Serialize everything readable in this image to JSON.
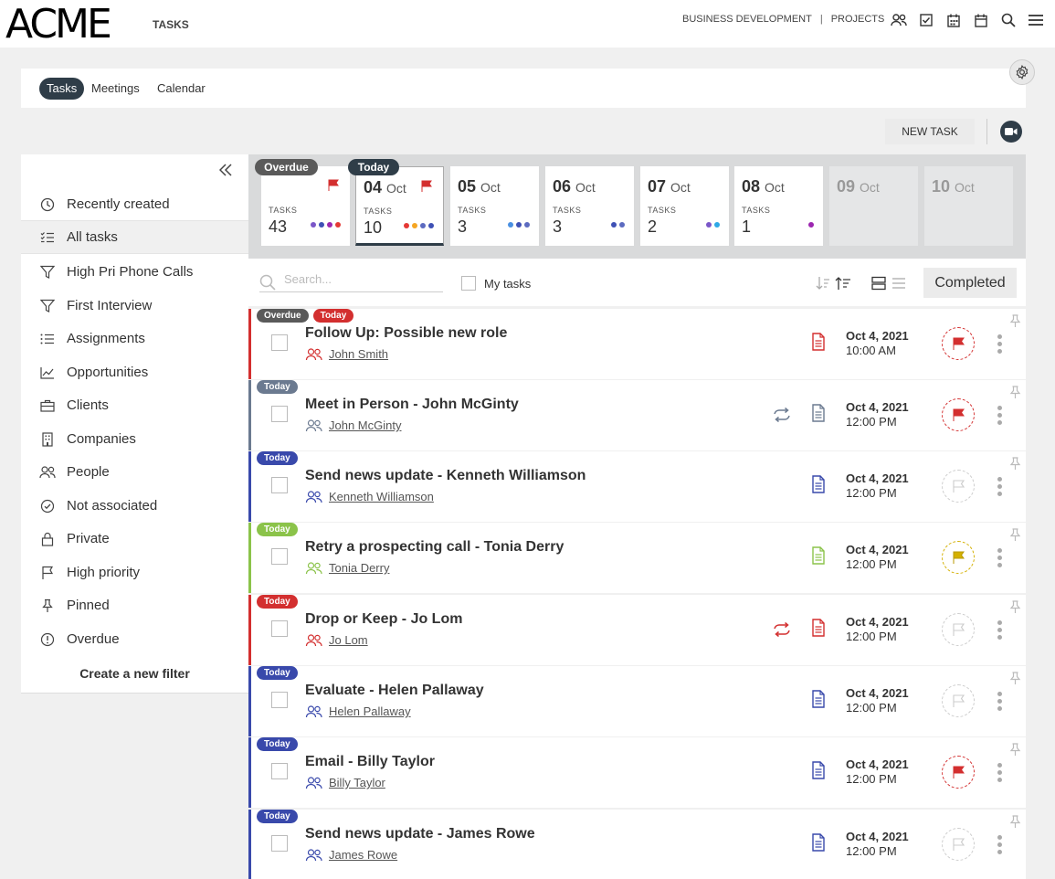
{
  "app": {
    "logo": "ACME",
    "title": "TASKS"
  },
  "topnav": {
    "items": [
      "BUSINESS DEVELOPMENT",
      "PROJECTS"
    ],
    "separator": "|",
    "icons": [
      "people-icon",
      "checkbox-icon",
      "calendar-grid-icon",
      "calendar-icon",
      "search-icon",
      "menu-icon"
    ]
  },
  "tabs": {
    "items": [
      "Tasks",
      "Meetings",
      "Calendar"
    ],
    "active": "Tasks"
  },
  "toolbar": {
    "new_task": "NEW TASK"
  },
  "sidebar": {
    "items": [
      {
        "label": "Recently created",
        "icon": "clock-icon"
      },
      {
        "label": "All tasks",
        "icon": "checklist-icon",
        "active": true
      },
      {
        "label": "High Pri Phone Calls",
        "icon": "filter-icon"
      },
      {
        "label": "First Interview",
        "icon": "filter-icon"
      },
      {
        "label": "Assignments",
        "icon": "list-icon"
      },
      {
        "label": "Opportunities",
        "icon": "chart-icon"
      },
      {
        "label": "Clients",
        "icon": "briefcase-icon"
      },
      {
        "label": "Companies",
        "icon": "building-icon"
      },
      {
        "label": "People",
        "icon": "people-icon"
      },
      {
        "label": "Not associated",
        "icon": "check-circle-icon"
      },
      {
        "label": "Private",
        "icon": "lock-icon"
      },
      {
        "label": "High priority",
        "icon": "flag-icon"
      },
      {
        "label": "Pinned",
        "icon": "pin-icon"
      },
      {
        "label": "Overdue",
        "icon": "alert-icon"
      }
    ],
    "create_filter": "Create a new filter"
  },
  "datestrip": {
    "tasks_label": "TASKS",
    "overdue_pill": "Overdue",
    "today_pill": "Today",
    "cards": [
      {
        "day": "",
        "month": "",
        "count": "43",
        "flag": true,
        "dots": [
          "#7b57c8",
          "#3f51b5",
          "#9c27b0",
          "#e53935"
        ]
      },
      {
        "day": "04",
        "month": "Oct",
        "count": "10",
        "flag": true,
        "dots": [
          "#e53935",
          "#f5a623",
          "#5c6bc0",
          "#3f51b5"
        ]
      },
      {
        "day": "05",
        "month": "Oct",
        "count": "3",
        "dots": [
          "#4a90e2",
          "#3f51b5",
          "#5c6bc0"
        ]
      },
      {
        "day": "06",
        "month": "Oct",
        "count": "3",
        "dots": [
          "#3f51b5",
          "#5c6bc0"
        ]
      },
      {
        "day": "07",
        "month": "Oct",
        "count": "2",
        "dots": [
          "#7b57c8",
          "#2ea8e6"
        ]
      },
      {
        "day": "08",
        "month": "Oct",
        "count": "1",
        "dots": [
          "#9c27b0"
        ]
      },
      {
        "day": "09",
        "month": "Oct",
        "count": "",
        "dots": []
      },
      {
        "day": "10",
        "month": "Oct",
        "count": "",
        "dots": []
      }
    ]
  },
  "filters": {
    "search_placeholder": "Search...",
    "my_tasks": "My tasks",
    "completed": "Completed"
  },
  "colors": {
    "overdue": "#5a5a5a",
    "red": "#d32f2f",
    "slate": "#6b7a90",
    "blue": "#3949ab",
    "green": "#8bc34a",
    "yellow": "#e0b800"
  },
  "tasks": [
    {
      "badges": [
        {
          "text": "Overdue",
          "color": "#5a5a5a"
        },
        {
          "text": "Today",
          "color": "#d32f2f"
        }
      ],
      "border": "#d32f2f",
      "title": "Follow Up: Possible new role",
      "person": "John Smith",
      "person_color": "#d32f2f",
      "recur": false,
      "doc_color": "#d32f2f",
      "date": "Oct 4, 2021",
      "time": "10:00 AM",
      "flag": "red"
    },
    {
      "badges": [
        {
          "text": "Today",
          "color": "#6b7a90"
        }
      ],
      "border": "#6b7a90",
      "title": "Meet in Person - John McGinty",
      "person": "John McGinty",
      "person_color": "#6b7a90",
      "recur": true,
      "recur_color": "#6b7a90",
      "doc_color": "#6b7a90",
      "date": "Oct 4, 2021",
      "time": "12:00 PM",
      "flag": "red"
    },
    {
      "badges": [
        {
          "text": "Today",
          "color": "#3949ab"
        }
      ],
      "border": "#3949ab",
      "title": "Send news update - Kenneth Williamson",
      "person": "Kenneth Williamson",
      "person_color": "#3949ab",
      "recur": false,
      "doc_color": "#3949ab",
      "date": "Oct 4, 2021",
      "time": "12:00 PM",
      "flag": "none"
    },
    {
      "badges": [
        {
          "text": "Today",
          "color": "#8bc34a"
        }
      ],
      "border": "#8bc34a",
      "title": "Retry a prospecting call - Tonia Derry",
      "person": "Tonia Derry",
      "person_color": "#8bc34a",
      "recur": false,
      "doc_color": "#8bc34a",
      "date": "Oct 4, 2021",
      "time": "12:00 PM",
      "flag": "yellow"
    },
    {
      "badges": [
        {
          "text": "Today",
          "color": "#d32f2f"
        }
      ],
      "border": "#d32f2f",
      "title": "Drop or Keep - Jo Lom",
      "person": "Jo Lom",
      "person_color": "#d32f2f",
      "recur": true,
      "recur_color": "#d32f2f",
      "doc_color": "#d32f2f",
      "date": "Oct 4, 2021",
      "time": "12:00 PM",
      "flag": "none"
    },
    {
      "badges": [
        {
          "text": "Today",
          "color": "#3949ab"
        }
      ],
      "border": "#3949ab",
      "title": "Evaluate - Helen Pallaway",
      "person": "Helen Pallaway",
      "person_color": "#3949ab",
      "recur": false,
      "doc_color": "#3949ab",
      "date": "Oct 4, 2021",
      "time": "12:00 PM",
      "flag": "none"
    },
    {
      "badges": [
        {
          "text": "Today",
          "color": "#3949ab"
        }
      ],
      "border": "#3949ab",
      "title": "Email - Billy Taylor",
      "person": "Billy Taylor",
      "person_color": "#3949ab",
      "recur": false,
      "doc_color": "#3949ab",
      "date": "Oct 4, 2021",
      "time": "12:00 PM",
      "flag": "red"
    },
    {
      "badges": [
        {
          "text": "Today",
          "color": "#3949ab"
        }
      ],
      "border": "#3949ab",
      "title": "Send news update - James Rowe",
      "person": "James Rowe",
      "person_color": "#3949ab",
      "recur": false,
      "doc_color": "#3949ab",
      "date": "Oct 4, 2021",
      "time": "12:00 PM",
      "flag": "none"
    }
  ]
}
